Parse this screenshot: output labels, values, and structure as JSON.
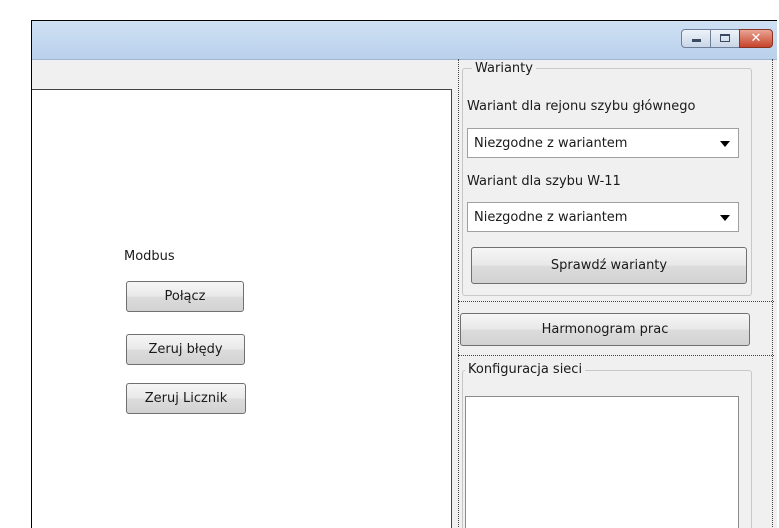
{
  "window": {
    "controls": {
      "minimize": "minimize",
      "maximize": "maximize",
      "close": "✕"
    }
  },
  "modbus": {
    "label": "Modbus",
    "connect_button": "Połącz",
    "reset_errors_button": "Zeruj błędy",
    "reset_counter_button": "Zeruj Licznik"
  },
  "variants": {
    "group_title": "Warianty",
    "main_shaft_label": "Wariant dla rejonu szybu głównego",
    "main_shaft_value": "Niezgodne z wariantem",
    "w11_label": "Wariant dla szybu W-11",
    "w11_value": "Niezgodne z wariantem",
    "check_button": "Sprawdź warianty"
  },
  "schedule_button": "Harmonogram prac",
  "network": {
    "group_title": "Konfiguracja sieci"
  }
}
